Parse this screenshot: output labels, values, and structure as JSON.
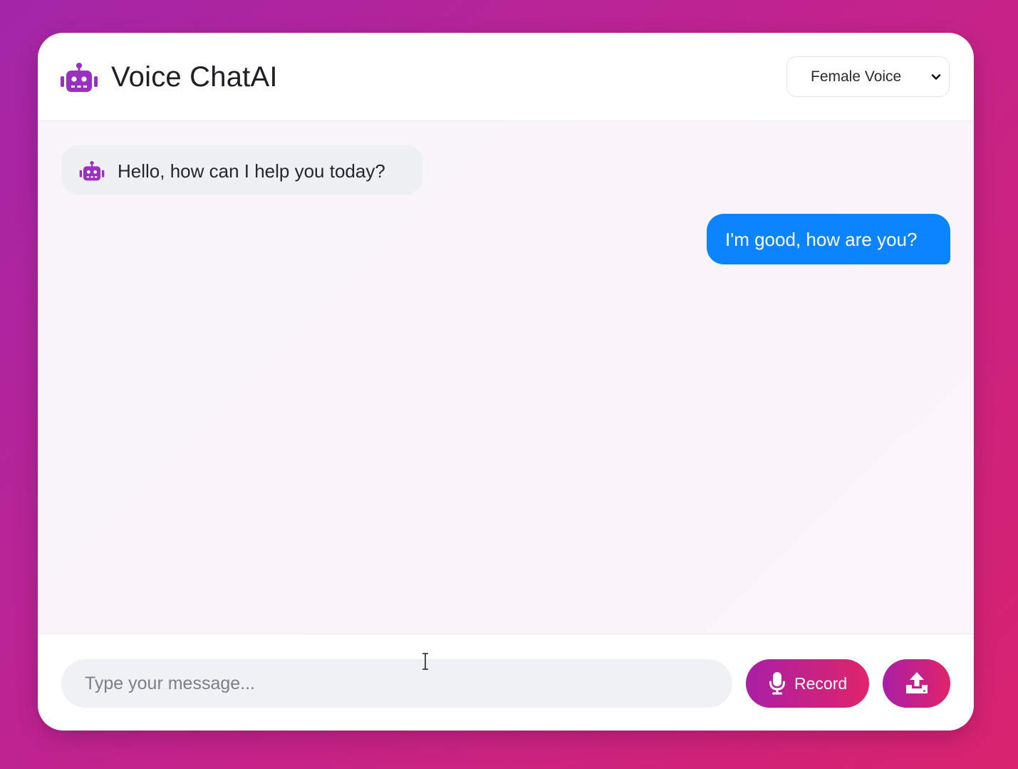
{
  "header": {
    "title": "Voice ChatAI",
    "logo_icon": "robot-icon",
    "voice_select": {
      "selected": "Female Voice",
      "icon": "chevron-down-icon"
    }
  },
  "messages": [
    {
      "role": "bot",
      "text": "Hello, how can I help you today?",
      "icon": "robot-icon"
    },
    {
      "role": "user",
      "text": "I'm good, how are you?"
    }
  ],
  "composer": {
    "input_placeholder": "Type your message...",
    "input_value": "",
    "record_label": "Record",
    "record_icon": "microphone-icon",
    "upload_icon": "upload-icon"
  },
  "colors": {
    "accent": "#a326a8",
    "accent_end": "#e0246a",
    "user_bubble": "#0a84ff",
    "bot_bubble": "#eef0f4",
    "robot_icon": "#9b2fc0"
  }
}
